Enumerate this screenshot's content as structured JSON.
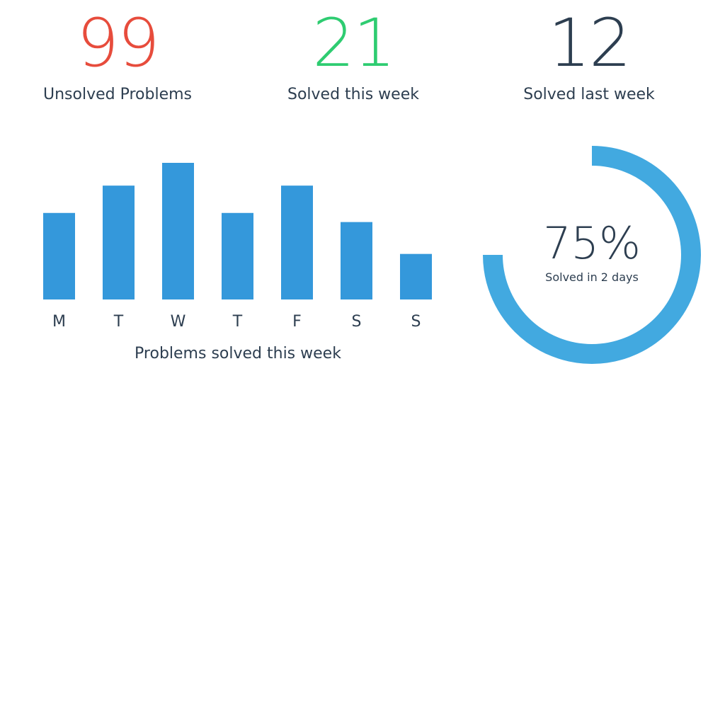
{
  "stats": [
    {
      "value": "99",
      "label": "Unsolved Problems",
      "color": "#e74c3c"
    },
    {
      "value": "21",
      "label": "Solved this week",
      "color": "#2ecc71"
    },
    {
      "value": "12",
      "label": "Solved last week",
      "color": "#2d3e50"
    }
  ],
  "chart_data": [
    {
      "type": "bar",
      "categories": [
        "M",
        "T",
        "W",
        "T",
        "F",
        "S",
        "S"
      ],
      "values": [
        3.8,
        5.0,
        6.0,
        3.8,
        5.0,
        3.4,
        2.0
      ],
      "title": "",
      "xlabel": "Problems solved this week",
      "ylabel": "",
      "ylim": [
        0,
        6.0
      ],
      "grid": false,
      "color": "#3498db"
    },
    {
      "type": "pie",
      "values": [
        75
      ],
      "value_label": "75%",
      "subtitle": "Solved in 2 days",
      "color": "#42a9e0"
    }
  ]
}
